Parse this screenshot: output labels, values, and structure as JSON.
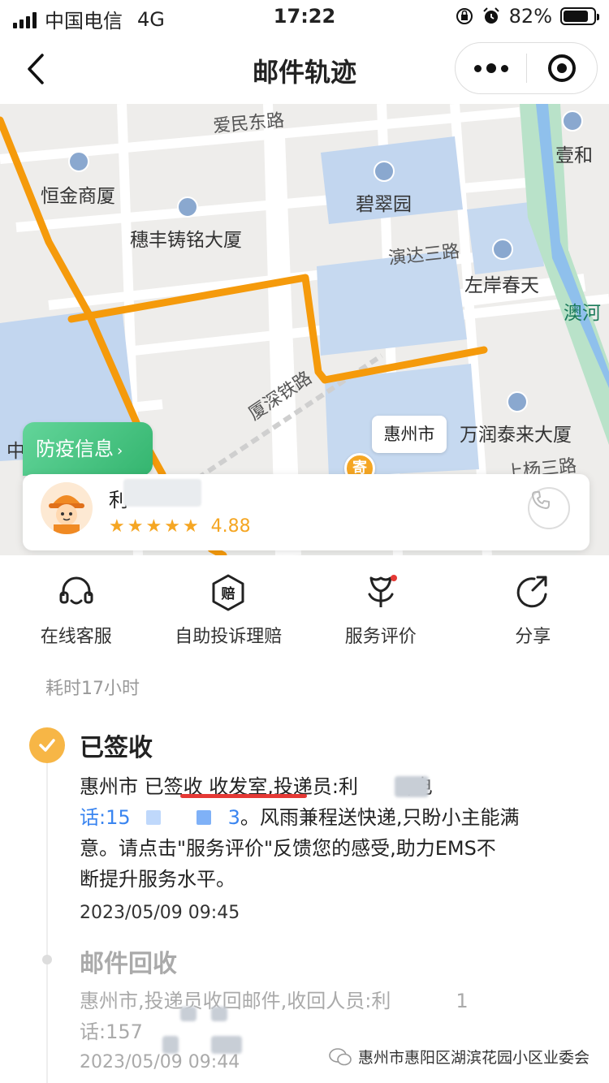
{
  "status_bar": {
    "carrier": "中国电信",
    "network": "4G",
    "time": "17:22",
    "battery": "82%",
    "battery_level": 0.82
  },
  "nav": {
    "title": "邮件轨迹"
  },
  "map": {
    "pois": [
      "恒金商厦",
      "穗丰铸铭大厦",
      "碧翠园",
      "左岸春天",
      "壹和",
      "万润泰来大厦",
      "中"
    ],
    "roads": [
      "爱民东路",
      "演达三路",
      "厦深铁路",
      "上杨三路"
    ],
    "river": "澳河",
    "city_bubble": "惠州市",
    "send_marker": "寄"
  },
  "epidemic_tab": {
    "label": "防疫信息",
    "arrow": "›"
  },
  "courier": {
    "name": "利",
    "rating": "4.88",
    "stars": 5
  },
  "actions": [
    {
      "label": "在线客服",
      "icon": "headset-icon"
    },
    {
      "label": "自助投诉理赔",
      "icon": "compensation-badge-icon"
    },
    {
      "label": "服务评价",
      "icon": "rate-flower-icon"
    },
    {
      "label": "分享",
      "icon": "share-icon"
    }
  ],
  "duration": "耗时17小时",
  "events": [
    {
      "title": "已签收",
      "line1": "惠州市 已签收 收发室,投递员:利",
      "line1_tail": ",电",
      "line2_head": "话:15",
      "line2_mid": "3",
      "line2_tail": "。风雨兼程送快递,只盼小主能满",
      "line3": "意。请点击\"服务评价\"反馈您的感受,助力EMS不",
      "line4": "断提升服务水平。",
      "time": "2023/05/09 09:45"
    },
    {
      "title": "邮件回收",
      "line1": "惠州市,投递员收回邮件,收回人员:利",
      "line1_tail": "1",
      "line2": "话:157",
      "time": "2023/05/09 09:44"
    }
  ],
  "watermark": "惠州市惠阳区湖滨花园小区业委会",
  "colors": {
    "route": "#f59a0b",
    "accent": "#f5a623",
    "epidemic": "#3bbd77",
    "underline": "#e53935"
  }
}
